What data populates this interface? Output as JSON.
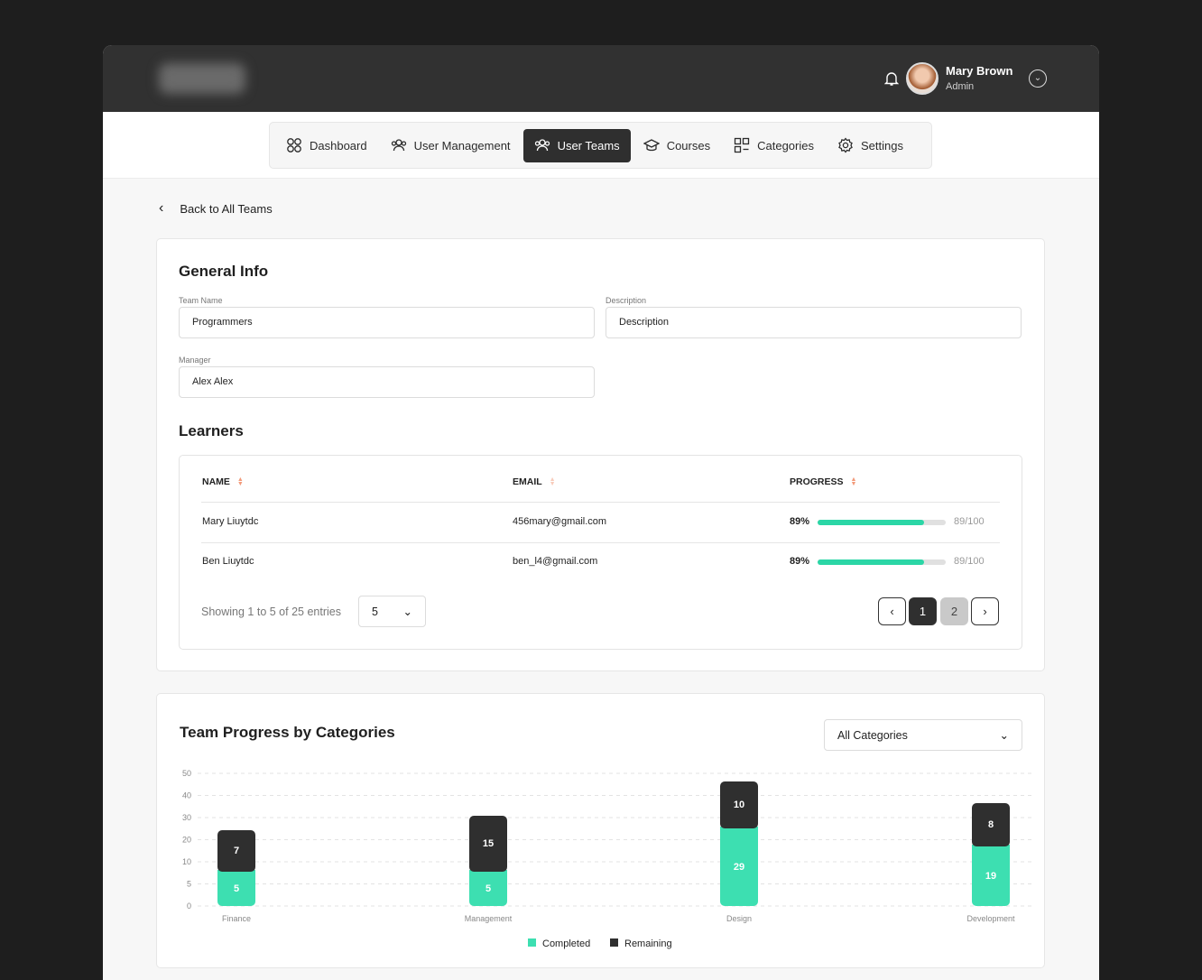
{
  "header": {
    "user_name": "Mary Brown",
    "user_role": "Admin"
  },
  "nav": [
    {
      "label": "Dashboard",
      "icon": "grid-circles-icon"
    },
    {
      "label": "User Management",
      "icon": "users-icon"
    },
    {
      "label": "User Teams",
      "icon": "team-icon",
      "active": true
    },
    {
      "label": "Courses",
      "icon": "graduation-cap-icon"
    },
    {
      "label": "Categories",
      "icon": "categories-icon"
    },
    {
      "label": "Settings",
      "icon": "gear-icon"
    }
  ],
  "back_label": "Back to All Teams",
  "general": {
    "title": "General Info",
    "team_name_label": "Team Name",
    "team_name": "Programmers",
    "description_label": "Description",
    "description": "Description",
    "manager_label": "Manager",
    "manager": "Alex Alex"
  },
  "learners": {
    "title": "Learners",
    "headers": {
      "name": "NAME",
      "email": "EMAIL",
      "progress": "PROGRESS"
    },
    "rows": [
      {
        "name": "Mary Liuytdc",
        "email": "456mary@gmail.com",
        "percent": "89%",
        "progress": 89,
        "score": "89/100"
      },
      {
        "name": "Ben Liuytdc",
        "email": "ben_l4@gmail.com",
        "percent": "89%",
        "progress": 89,
        "score": "89/100"
      }
    ],
    "showing": "Showing 1 to 5 of 25 entries",
    "page_size": "5",
    "pages": [
      "1",
      "2"
    ],
    "current_page": "1"
  },
  "chart_section": {
    "title": "Team Progress by Categories",
    "filter": "All Categories"
  },
  "chart_data": {
    "type": "bar",
    "stacked": true,
    "categories": [
      "Finance",
      "Management",
      "Design",
      "Development"
    ],
    "series": [
      {
        "name": "Completed",
        "color": "#3ddfb1",
        "values": [
          5,
          5,
          29,
          19
        ]
      },
      {
        "name": "Remaining",
        "color": "#2f2f2f",
        "values": [
          7,
          15,
          10,
          8
        ]
      }
    ],
    "yticks": [
      "0",
      "5",
      "10",
      "20",
      "30",
      "40",
      "50"
    ],
    "legend": "bottom",
    "grid": true
  }
}
